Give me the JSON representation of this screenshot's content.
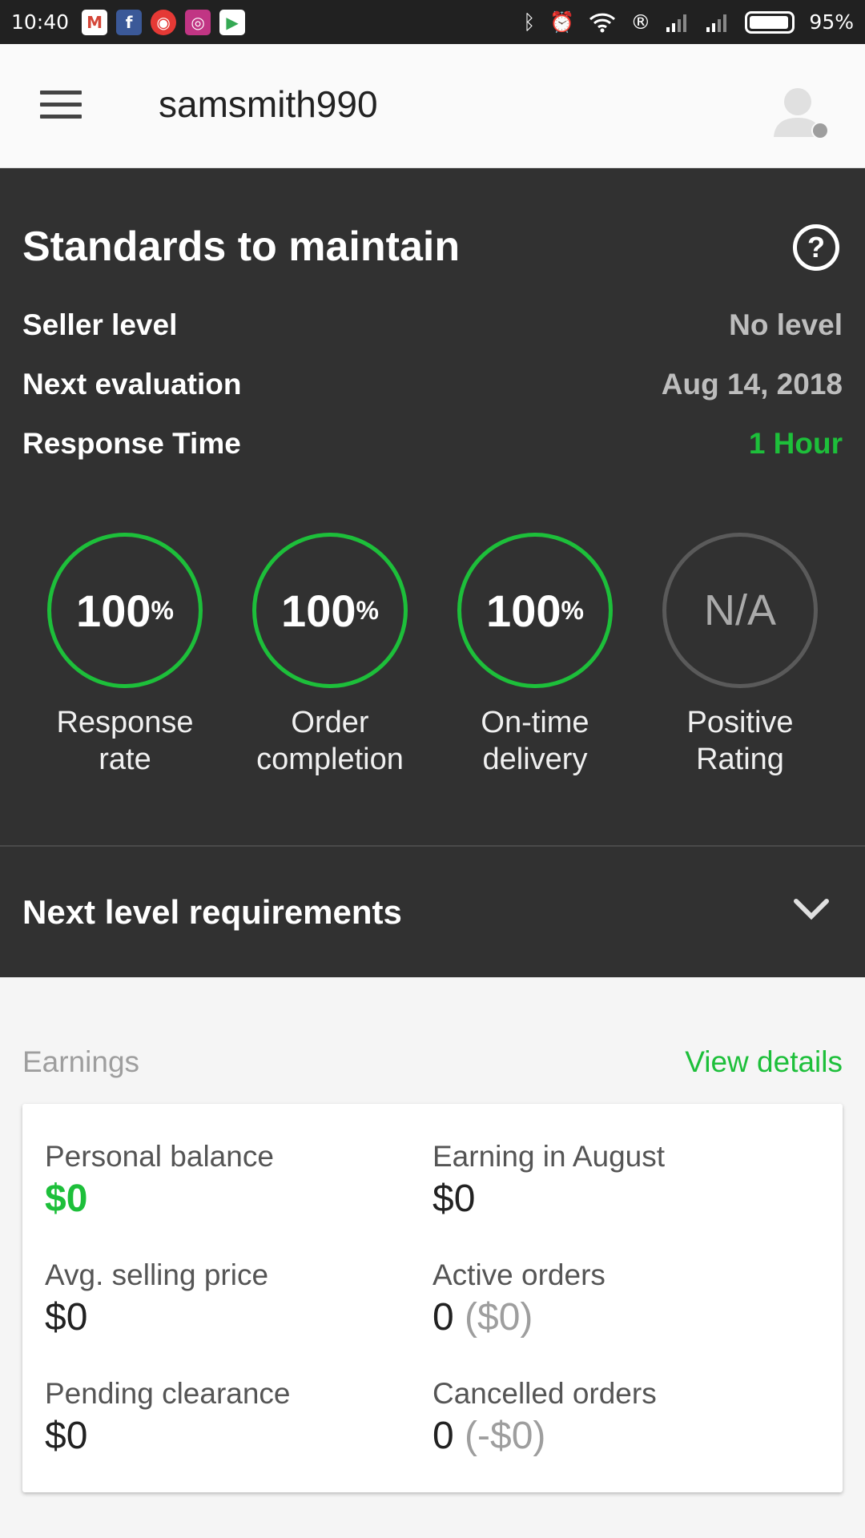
{
  "status_bar": {
    "time": "10:40",
    "battery": "95%",
    "battery_level": 0.95,
    "apps": [
      "gmail-icon",
      "facebook-icon",
      "rss-icon",
      "instagram-icon",
      "play-store-icon"
    ],
    "system_icons": [
      "bluetooth-icon",
      "alarm-icon",
      "wifi-icon",
      "registered-icon",
      "signal-icon",
      "signal-icon"
    ]
  },
  "appbar": {
    "username": "samsmith990"
  },
  "standards": {
    "title": "Standards to maintain",
    "rows": [
      {
        "label": "Seller level",
        "value": "No level"
      },
      {
        "label": "Next evaluation",
        "value": "Aug 14, 2018"
      },
      {
        "label": "Response Time",
        "value": "1 Hour"
      }
    ],
    "stats": [
      {
        "value": "100",
        "unit": "%",
        "label_line1": "Response",
        "label_line2": "rate"
      },
      {
        "value": "100",
        "unit": "%",
        "label_line1": "Order",
        "label_line2": "completion"
      },
      {
        "value": "100",
        "unit": "%",
        "label_line1": "On-time",
        "label_line2": "delivery"
      },
      {
        "value": "N/A",
        "unit": "",
        "label_line1": "Positive",
        "label_line2": "Rating"
      }
    ]
  },
  "next_level": {
    "label": "Next level requirements"
  },
  "earnings": {
    "heading": "Earnings",
    "view_details": "View details",
    "items": [
      {
        "title": "Personal balance",
        "value": "$0",
        "extra": ""
      },
      {
        "title": "Earning in August",
        "value": "$0",
        "extra": ""
      },
      {
        "title": "Avg. selling price",
        "value": "$0",
        "extra": ""
      },
      {
        "title": "Active orders",
        "value": "0",
        "extra": "($0)"
      },
      {
        "title": "Pending clearance",
        "value": "$0",
        "extra": ""
      },
      {
        "title": "Cancelled orders",
        "value": "0",
        "extra": "(-$0)"
      }
    ]
  },
  "colors": {
    "accent": "#1dbf3a",
    "panel": "#313131",
    "status_bar": "#212121"
  }
}
